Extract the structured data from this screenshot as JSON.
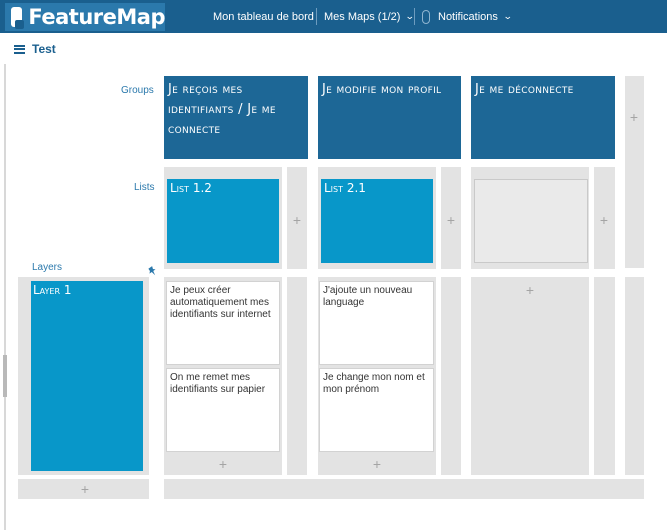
{
  "header": {
    "logo_text": "FeatureMap",
    "nav_dashboard": "Mon tableau de bord",
    "nav_maps": "Mes Maps (1/2)",
    "nav_notifications": "Notifications"
  },
  "board": {
    "title": "Test"
  },
  "labels": {
    "groups": "Groups",
    "lists": "Lists",
    "layers": "Layers"
  },
  "groups": [
    {
      "title": "Je reçois mes identifiants / Je me connecte"
    },
    {
      "title": "Je modifie mon profil"
    },
    {
      "title": "Je me déconnecte"
    }
  ],
  "lists": [
    {
      "title": "List 1.2"
    },
    {
      "title": "List 2.1"
    }
  ],
  "layers": [
    {
      "title": "Layer 1"
    }
  ],
  "stories": {
    "col1": [
      "Je peux créer automatiquement mes identifiants sur internet",
      "On me remet mes identifiants sur papier"
    ],
    "col2": [
      "J'ajoute un nouveau language",
      "Je change mon nom et mon prénom"
    ]
  },
  "icons": {
    "plus": "+"
  },
  "colors": {
    "topbar": "#1a5f8e",
    "group": "#1d6796",
    "list": "#0897c9",
    "grey": "#e3e3e3"
  }
}
